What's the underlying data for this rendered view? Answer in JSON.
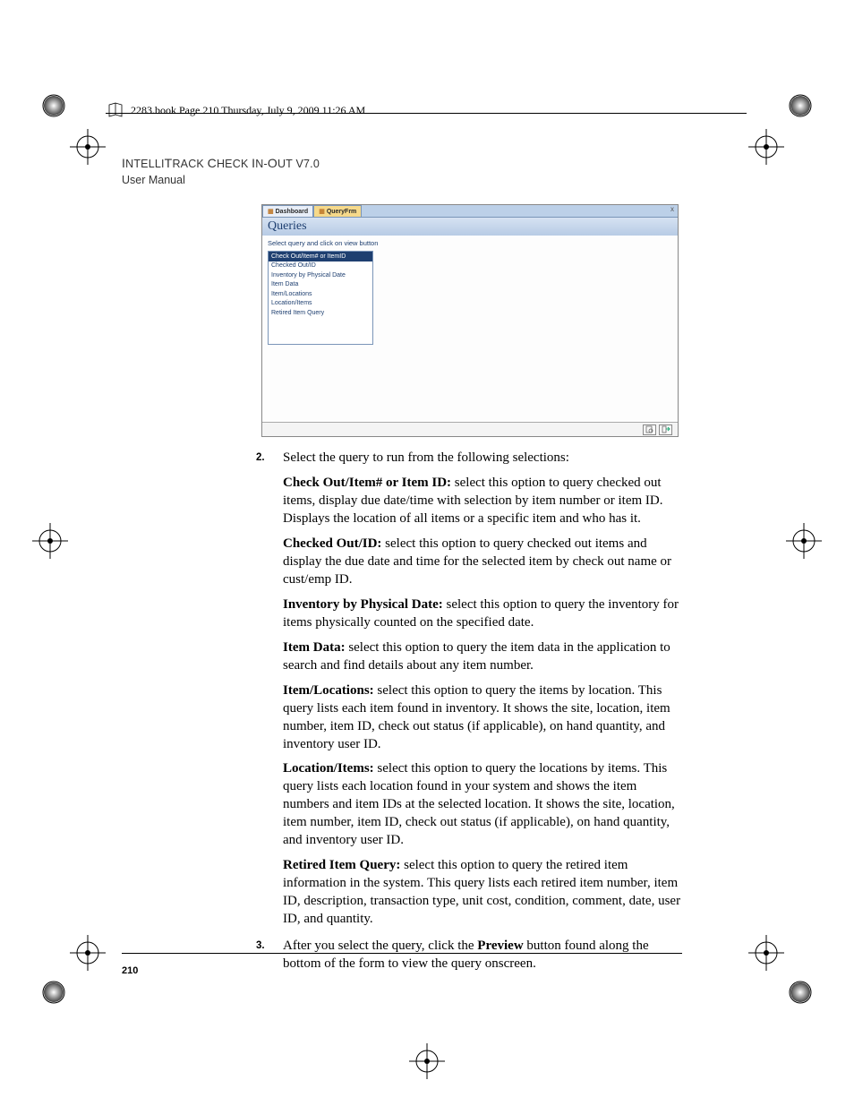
{
  "page_tag": "2283.book  Page 210  Thursday, July 9, 2009  11:26 AM",
  "header": {
    "title": "IntelliTrack Check In-Out v7.0",
    "subtitle": "User Manual"
  },
  "screenshot": {
    "tabs": [
      "Dashboard",
      "QueryFrm"
    ],
    "close_x": "x",
    "title": "Queries",
    "instruction": "Select query and click on view button",
    "items": [
      "Check Out/Item# or ItemID",
      "Checked Out/ID",
      "Inventory by Physical Date",
      "Item Data",
      "Item/Locations",
      "Location/Items",
      "Retired Item Query"
    ]
  },
  "steps": {
    "s2": {
      "num": "2.",
      "lead": "Select the query to run from the following selections:"
    },
    "s3": {
      "num": "3.",
      "text_a": "After you select the query, click the ",
      "bold": "Preview",
      "text_b": " button found along the bottom of the form to view the query onscreen."
    }
  },
  "options": {
    "o1": {
      "b": "Check Out/Item# or Item ID:",
      "t": " select this option to query checked out items, display due date/time with selection by item number or item ID. Displays the location of all items or a specific item and who has it."
    },
    "o2": {
      "b": "Checked Out/ID:",
      "t": " select this option to query checked out items and display the due date and time for the selected item by check out name or cust/emp ID."
    },
    "o3": {
      "b": "Inventory by Physical Date:",
      "t": " select this option to query the inventory for items physically counted on the specified date."
    },
    "o4": {
      "b": "Item Data:",
      "t": " select this option to query the item data in the application to search and find details about any item number."
    },
    "o5": {
      "b": "Item/Locations:",
      "t": " select this option to query the items by location. This query lists each item found in inventory. It shows the site, location, item number, item ID, check out status (if applicable), on hand quantity, and inventory user ID."
    },
    "o6": {
      "b": "Location/Items:",
      "t": " select this option to query the locations by items. This query lists each location found in your system and shows the item numbers and item IDs at the selected location. It shows the site, location, item number, item ID, check out status (if applicable), on hand quantity, and inventory user ID."
    },
    "o7": {
      "b": "Retired Item Query:",
      "t": " select this option to query the retired item information in the system. This query lists each retired item number, item ID, description, transaction type, unit cost, condition, comment, date, user ID, and quantity."
    }
  },
  "page_number": "210"
}
